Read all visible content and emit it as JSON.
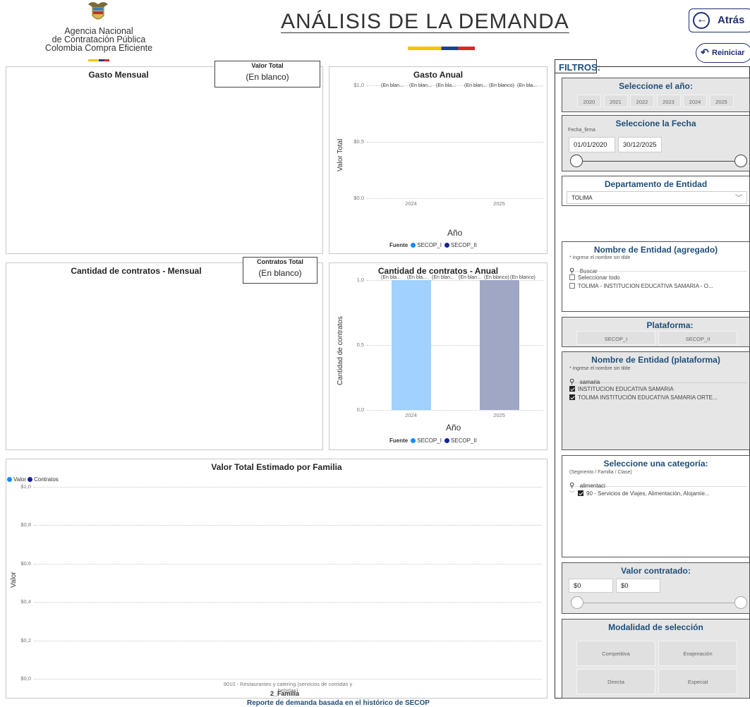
{
  "header": {
    "agency_line1": "Agencia Nacional",
    "agency_line2": "de Contratación Pública",
    "agency_line3": "Colombia Compra Eficiente",
    "title": "ANÁLISIS DE LA DEMANDA",
    "back_label": "Atrás",
    "reset_label": "Reiniciar"
  },
  "cards": {
    "valor_total": {
      "title": "Valor Total",
      "value": "(En blanco)"
    },
    "contratos_total": {
      "title": "Contratos Total",
      "value": "(En blanco)"
    }
  },
  "panels": {
    "gasto_mensual": "Gasto Mensual",
    "cantidad_mensual": "Cantidad de contratos - Mensual"
  },
  "chart_data": [
    {
      "type": "bar",
      "title": "Gasto Anual",
      "ylabel": "Valor Total",
      "xlabel": "Año",
      "categories": [
        "2024",
        "2025"
      ],
      "yticks": [
        "$1,0",
        "$0,5",
        "$0,0"
      ],
      "ylim": [
        0,
        1
      ],
      "series": [
        {
          "name": "SECOP_I",
          "color": "#118dff",
          "values": [
            0,
            0
          ]
        },
        {
          "name": "SECOP_II",
          "color": "#12239e",
          "values": [
            0,
            0
          ]
        }
      ],
      "data_labels": [
        "(En blan...",
        "(En blan...",
        "(En bla...",
        "(En blan...",
        "(En blanco)",
        "(En bla..."
      ],
      "legend_title": "Fuente"
    },
    {
      "type": "bar",
      "title": "Cantidad de contratos - Anual",
      "ylabel": "Cantidad de contratos",
      "xlabel": "Año",
      "categories": [
        "2024",
        "2025"
      ],
      "yticks": [
        "1,0",
        "0,5",
        "0,0"
      ],
      "ylim": [
        0,
        1
      ],
      "series": [
        {
          "name": "SECOP_I",
          "color": "#a0d1ff",
          "values": [
            1,
            0
          ]
        },
        {
          "name": "SECOP_II",
          "color": "#a0a7c5",
          "values": [
            0,
            1
          ]
        }
      ],
      "data_labels": [
        "(En bla...",
        "(En bla...",
        "(En blan...",
        "(En blan...",
        "(En blanco)",
        "(En blanco)"
      ],
      "legend_title": "Fuente"
    },
    {
      "type": "bar",
      "title": "Valor Total Estimado por Familia",
      "ylabel": "Valor",
      "xlabel": "2_Familia",
      "categories": [
        "9010 - Restaurantes y catering (servicios de comidas y bebidas)"
      ],
      "yticks": [
        "$1,0",
        "$0,8",
        "$0,6",
        "$0,4",
        "$0,2",
        "$0,0"
      ],
      "ylim": [
        0,
        1
      ],
      "series": [
        {
          "name": "Valor",
          "color": "#118dff",
          "values": [
            0
          ]
        },
        {
          "name": "Contratos",
          "color": "#12239e",
          "values": [
            0
          ]
        }
      ]
    }
  ],
  "filters": {
    "title": "FILTROS:",
    "year": {
      "heading": "Seleccione el año:",
      "options": [
        "2020",
        "2021",
        "2022",
        "2023",
        "2024",
        "2025"
      ]
    },
    "date": {
      "heading": "Seleccione la Fecha",
      "field": "Fecha_firma",
      "start": "01/01/2020",
      "end": "30/12/2025"
    },
    "department": {
      "heading": "Departamento de Entidad",
      "selected": "TOLIMA"
    },
    "entity_agg": {
      "heading": "Nombre de Entidad (agregado)",
      "hint": "* ingrese el nombre sin tilde",
      "search_placeholder": "Buscar",
      "items": [
        "Seleccionar todo",
        "TOLIMA - INSTITUCION EDUCATIVA SAMARIA - O..."
      ]
    },
    "platform": {
      "heading": "Plataforma:",
      "options": [
        "SECOP_I",
        "SECOP_II"
      ]
    },
    "entity_plat": {
      "heading": "Nombre de Entidad (plataforma)",
      "hint": "* ingrese el nombre sin tilde",
      "search_value": "samaria",
      "items": [
        "INSTITUCION EDUCATIVA SAMARIA",
        "TOLIMA INSTITUCIÓN EDUCATIVA SAMARIA ORTE..."
      ]
    },
    "category": {
      "heading": "Seleccione una categoría:",
      "hint": "(Segmento / Familia / Clase)",
      "search_value": "alimentaci",
      "item": "90 - Servicios de Viajes, Alimentación, Alojamie..."
    },
    "valor": {
      "heading": "Valor contratado:",
      "min": "$0",
      "max": "$0"
    },
    "modalidad": {
      "heading": "Modalidad de selección",
      "options": [
        "Competitiva",
        "Enajenación",
        "Directa",
        "Especial"
      ]
    }
  },
  "footer": {
    "text": "Reporte de demanda basada en el histórico de SECOP"
  }
}
